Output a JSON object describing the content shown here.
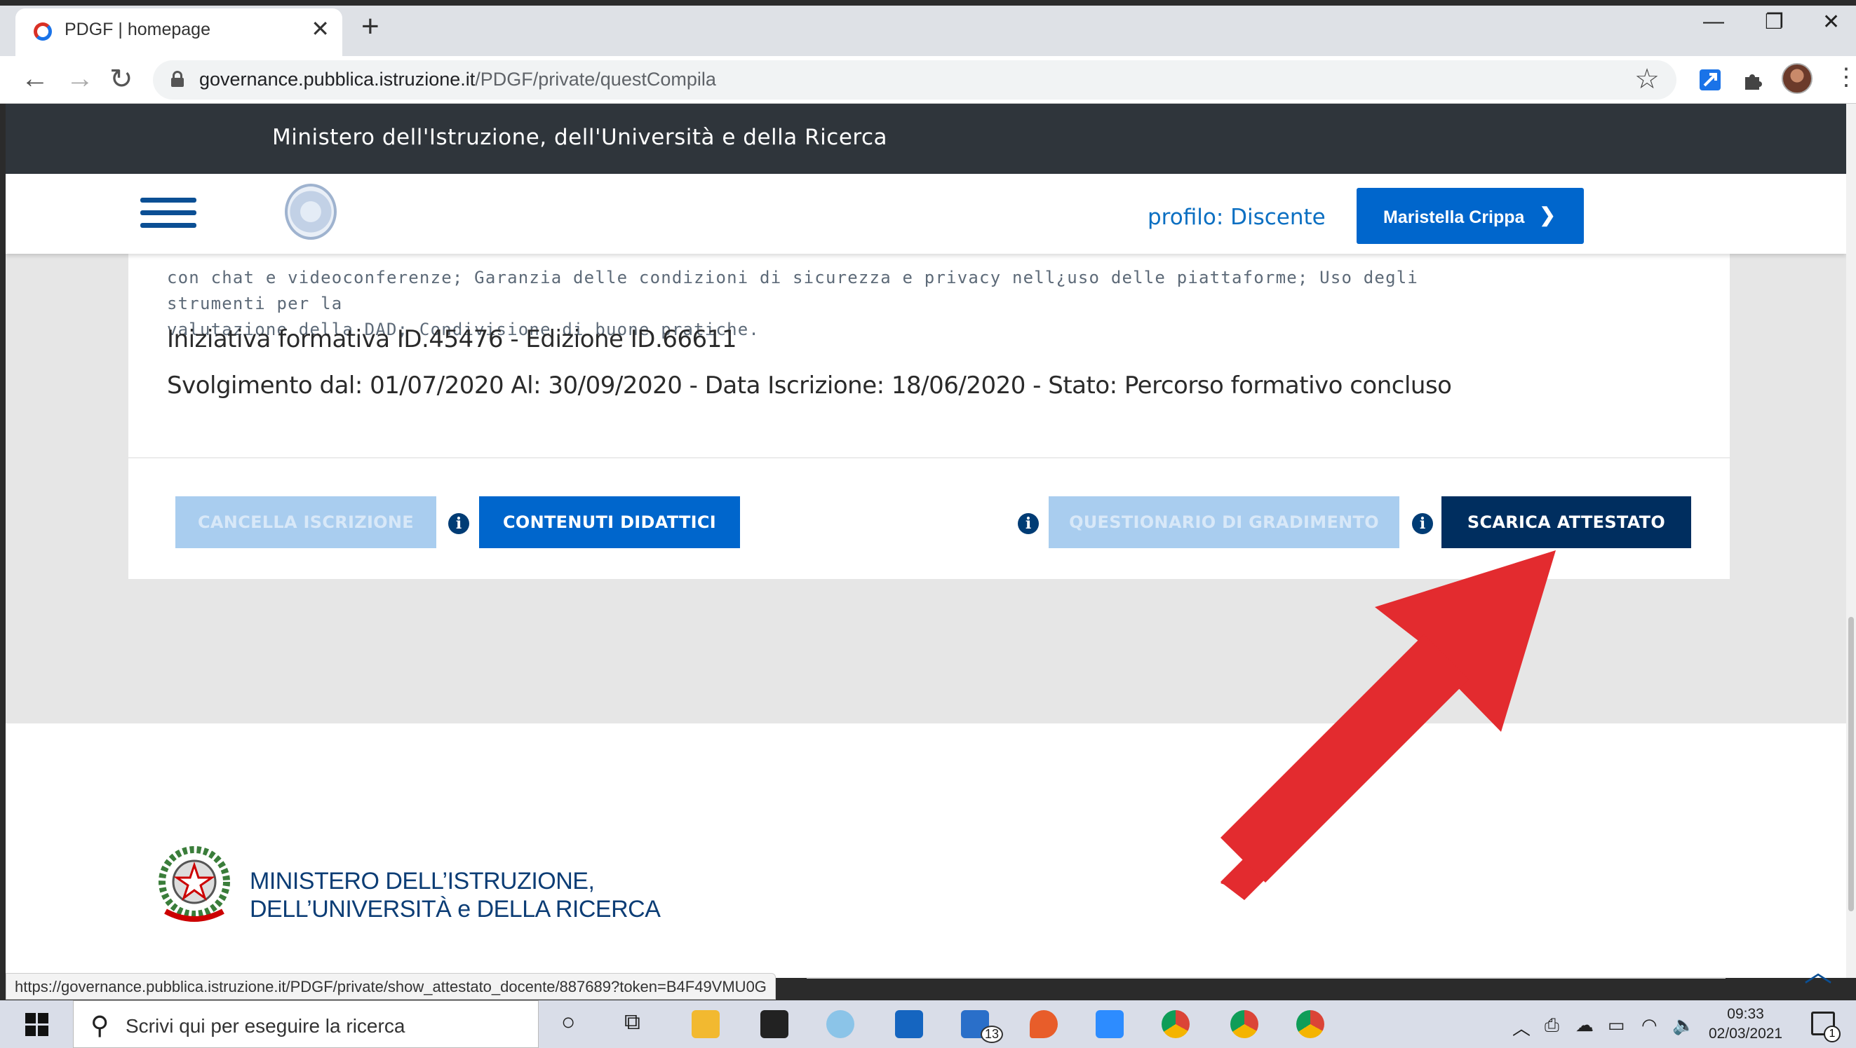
{
  "browser": {
    "tab_title": "PDGF | homepage",
    "tab_close": "✕",
    "new_tab": "+",
    "url_domain": "governance.pubblica.istruzione.it",
    "url_path": "/PDGF/private/questCompila",
    "window_controls": [
      "—",
      "❐",
      "✕"
    ],
    "nav": {
      "back": "←",
      "forward": "→",
      "reload": "↻"
    },
    "menu": "⋮",
    "star": "☆"
  },
  "header": {
    "ministry": "Ministero dell'Istruzione, dell'Università e della Ricerca",
    "profile_label": "profilo: Discente",
    "user_name": "Maristella Crippa"
  },
  "course": {
    "description_line1": "con chat e videoconferenze; Garanzia delle condizioni di sicurezza e privacy nell¿uso delle piattaforme; Uso degli strumenti per la",
    "description_line2": "valutazione della DAD; Condivisione di buone pratiche.",
    "initiative": "Iniziativa formativa ID.45476 - Edizione ID.66611",
    "schedule": "Svolgimento dal: 01/07/2020 Al: 30/09/2020 - Data Iscrizione: 18/06/2020 - Stato: Percorso formativo concluso"
  },
  "actions": {
    "cancel_enrollment": "CANCELLA ISCRIZIONE",
    "course_content": "CONTENUTI DIDATTICI",
    "satisfaction_survey": "QUESTIONARIO DI GRADIMENTO",
    "download_certificate": "SCARICA ATTESTATO",
    "info_glyph": "i"
  },
  "footer": {
    "title_line1": "MINISTERO DELL’ISTRUZIONE,",
    "title_line2": "DELL’UNIVERSITÀ e DELLA RICERCA",
    "back_to_top": "︿"
  },
  "status_bar": {
    "hover_url": "https://governance.pubblica.istruzione.it/PDGF/private/show_attestato_docente/887689?token=B4F49VMU0G"
  },
  "taskbar": {
    "search_placeholder": "Scrivi qui per eseguire la ricerca",
    "mail_badge": "13",
    "time": "09:33",
    "date": "02/03/2021",
    "notification_count": "1"
  },
  "colors": {
    "primary": "#0066cc",
    "dark_primary": "#002e5f",
    "disabled": "#a9cdef",
    "ministry_bar": "#2f353b",
    "arrow": "#e32b2f"
  }
}
